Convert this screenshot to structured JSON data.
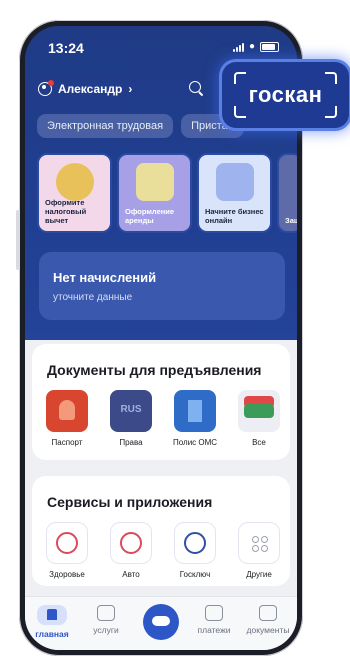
{
  "status": {
    "time": "13:24"
  },
  "header": {
    "user_name": "Александр"
  },
  "chips": [
    "Электронная трудовая",
    "Пристав"
  ],
  "promos": [
    {
      "label": "Оформите налоговый вычет"
    },
    {
      "label": "Оформление аренды"
    },
    {
      "label": "Начните бизнес онлайн"
    },
    {
      "label": "Защ..."
    }
  ],
  "charges": {
    "title": "Нет начислений",
    "subtitle": "уточните данные"
  },
  "documents": {
    "title": "Документы для предъявления",
    "items": [
      {
        "label": "Паспорт"
      },
      {
        "label": "Права"
      },
      {
        "label": "Полис ОМС"
      },
      {
        "label": "Все"
      }
    ]
  },
  "services": {
    "title": "Сервисы и приложения",
    "items": [
      {
        "label": "Здоровье"
      },
      {
        "label": "Авто"
      },
      {
        "label": "Госключ"
      },
      {
        "label": "Другие"
      }
    ]
  },
  "tabs": [
    {
      "label": "главная",
      "active": true
    },
    {
      "label": "услуги"
    },
    {
      "label": "платежи"
    },
    {
      "label": "документы"
    }
  ],
  "overlay": {
    "badge_text": "госкан"
  }
}
